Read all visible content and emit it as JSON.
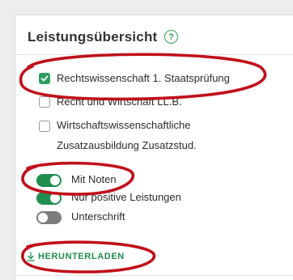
{
  "panel": {
    "title": "Leistungsübersicht",
    "help_icon": "question-circle-icon",
    "help_glyph": "?"
  },
  "checkboxes": [
    {
      "label": "Rechtswissenschaft 1. Staatsprüfung",
      "checked": true
    },
    {
      "label": "Recht und Wirtschaft LL.B.",
      "checked": false
    },
    {
      "label": "Wirtschaftswissenschaftliche",
      "label_line2": "Zusatzausbildung Zusatzstud.",
      "checked": false
    }
  ],
  "toggles": [
    {
      "label": "Mit Noten",
      "on": true
    },
    {
      "label": "Nur positive Leistungen",
      "on": true
    },
    {
      "label": "Unterschrift",
      "on": false
    }
  ],
  "download": {
    "label": "HERUNTERLADEN",
    "icon": "download-arrow-icon"
  },
  "colors": {
    "accent": "#1e8e4e",
    "annotation": "#c0101a",
    "toggle_off": "#7c7c7c"
  }
}
